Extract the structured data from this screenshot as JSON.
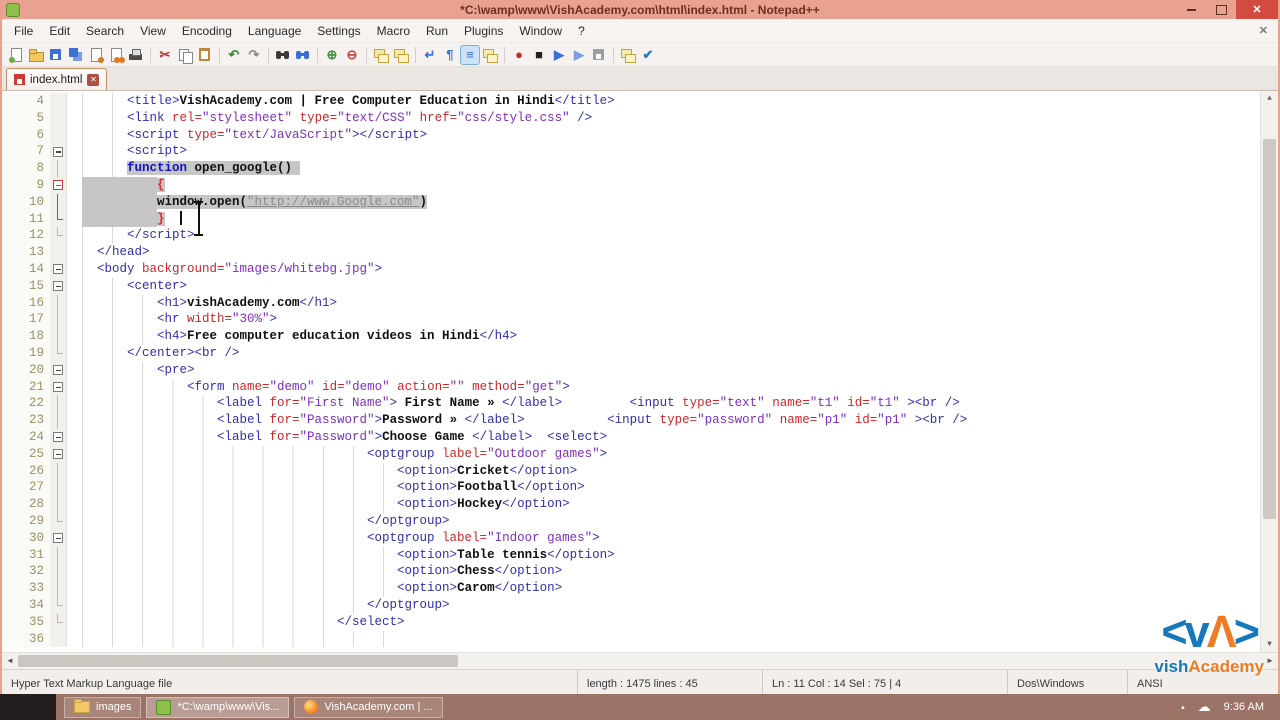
{
  "window": {
    "title": "*C:\\wamp\\www\\VishAcademy.com\\html\\index.html - Notepad++",
    "close_glyph": "✕",
    "doc_close_glyph": "✕"
  },
  "menu": {
    "items": [
      {
        "label": "File",
        "name": "file"
      },
      {
        "label": "Edit",
        "name": "edit"
      },
      {
        "label": "Search",
        "name": "search"
      },
      {
        "label": "View",
        "name": "view"
      },
      {
        "label": "Encoding",
        "name": "encoding"
      },
      {
        "label": "Language",
        "name": "language"
      },
      {
        "label": "Settings",
        "name": "settings"
      },
      {
        "label": "Macro",
        "name": "macro"
      },
      {
        "label": "Run",
        "name": "run"
      },
      {
        "label": "Plugins",
        "name": "plugins"
      },
      {
        "label": "Window",
        "name": "window"
      },
      {
        "label": "?",
        "name": "help"
      }
    ]
  },
  "toolbar": {
    "items": [
      {
        "name": "new-file",
        "type": "pagenew"
      },
      {
        "name": "open-file",
        "type": "folder"
      },
      {
        "name": "save",
        "type": "disk"
      },
      {
        "name": "save-all",
        "type": "disk2"
      },
      {
        "name": "close",
        "type": "pagedot"
      },
      {
        "name": "close-all",
        "type": "pagedot2"
      },
      {
        "name": "print",
        "type": "printer"
      },
      {
        "sep": true
      },
      {
        "name": "cut",
        "glyph": "✂",
        "color": "#b03030"
      },
      {
        "name": "copy",
        "type": "pages"
      },
      {
        "name": "paste",
        "type": "clipboard"
      },
      {
        "sep": true
      },
      {
        "name": "undo",
        "glyph": "↶",
        "color": "#2e8b2e"
      },
      {
        "name": "redo",
        "glyph": "↷",
        "color": "#8a8a8a"
      },
      {
        "sep": true
      },
      {
        "name": "find",
        "type": "binoc"
      },
      {
        "name": "replace",
        "type": "binocb"
      },
      {
        "sep": true
      },
      {
        "name": "zoom-in",
        "glyph": "⊕",
        "color": "#3f8f3f"
      },
      {
        "name": "zoom-out",
        "glyph": "⊖",
        "color": "#c04040"
      },
      {
        "sep": true
      },
      {
        "name": "sync-vertical-scrolling",
        "type": "winpair"
      },
      {
        "name": "sync-horizontal-scrolling",
        "type": "winpair"
      },
      {
        "sep": true
      },
      {
        "name": "word-wrap",
        "glyph": "↵",
        "color": "#3a6fd8"
      },
      {
        "name": "show-all-characters",
        "glyph": "¶",
        "color": "#3a6fd8"
      },
      {
        "name": "show-indent-guide",
        "glyph": "≡",
        "color": "#3a6fd8",
        "active": true
      },
      {
        "name": "user-defined-dialog",
        "type": "winpair"
      },
      {
        "sep": true
      },
      {
        "name": "record-macro",
        "glyph": "●",
        "color": "#c03030"
      },
      {
        "name": "stop-recording",
        "glyph": "■",
        "color": "#222222"
      },
      {
        "name": "play-macro",
        "glyph": "▶",
        "color": "#3a6fd8"
      },
      {
        "name": "run-macro-multiple",
        "glyph": "▶",
        "color": "#7d9ce0"
      },
      {
        "name": "save-macro",
        "type": "diskg"
      },
      {
        "sep": true
      },
      {
        "name": "document-map",
        "type": "winpair"
      },
      {
        "name": "spell-check",
        "glyph": "✔",
        "color": "#2a7ab8"
      }
    ]
  },
  "tabs": [
    {
      "label": "index.html",
      "state": "unsaved"
    }
  ],
  "editor": {
    "first_line": 4,
    "lines": [
      {
        "n": 4,
        "ind": 6,
        "f": "",
        "segs": [
          [
            "g",
            "<title>"
          ],
          [
            "t",
            "VishAcademy.com | Free Computer Education in Hindi"
          ],
          [
            "g",
            "</title>"
          ]
        ]
      },
      {
        "n": 5,
        "ind": 6,
        "f": "",
        "segs": [
          [
            "g",
            "<link "
          ],
          [
            "a",
            "rel="
          ],
          [
            "v",
            "\"stylesheet\""
          ],
          [
            "p",
            " "
          ],
          [
            "a",
            "type="
          ],
          [
            "v",
            "\"text/CSS\""
          ],
          [
            "p",
            " "
          ],
          [
            "a",
            "href="
          ],
          [
            "v",
            "\"css/style.css\""
          ],
          [
            "g",
            " />"
          ]
        ]
      },
      {
        "n": 6,
        "ind": 6,
        "f": "",
        "segs": [
          [
            "g",
            "<script "
          ],
          [
            "a",
            "type="
          ],
          [
            "v",
            "\"text/JavaScript\""
          ],
          [
            "g",
            "></script>"
          ]
        ]
      },
      {
        "n": 7,
        "ind": 6,
        "f": "box",
        "segs": [
          [
            "g",
            "<script>"
          ]
        ]
      },
      {
        "n": 8,
        "ind": 6,
        "f": "line",
        "segs": [
          [
            "k",
            "function",
            1
          ],
          [
            "t",
            " open_google()",
            1
          ],
          [
            "p",
            " ",
            1
          ]
        ]
      },
      {
        "n": 9,
        "ind": 10,
        "isel": 1,
        "f": "boxr",
        "segs": [
          [
            "b",
            "{",
            1
          ]
        ]
      },
      {
        "n": 10,
        "ind": 10,
        "isel": 1,
        "f": "liner",
        "segs": [
          [
            "t",
            "window.open(",
            1
          ],
          [
            "su",
            "\"http://www.Google.com\"",
            1
          ],
          [
            "t",
            ")",
            1
          ]
        ]
      },
      {
        "n": 11,
        "ind": 10,
        "isel": 1,
        "f": "endr",
        "segs": [
          [
            "b",
            "}",
            1
          ]
        ]
      },
      {
        "n": 12,
        "ind": 6,
        "f": "end",
        "segs": [
          [
            "g",
            "</script>"
          ]
        ]
      },
      {
        "n": 13,
        "ind": 2,
        "f": "",
        "segs": [
          [
            "g",
            "</head>"
          ]
        ]
      },
      {
        "n": 14,
        "ind": 2,
        "f": "box",
        "segs": [
          [
            "g",
            "<body "
          ],
          [
            "a",
            "background="
          ],
          [
            "v",
            "\"images/whitebg.jpg\""
          ],
          [
            "g",
            ">"
          ]
        ]
      },
      {
        "n": 15,
        "ind": 6,
        "f": "box",
        "segs": [
          [
            "g",
            "<center>"
          ]
        ]
      },
      {
        "n": 16,
        "ind": 10,
        "f": "line",
        "segs": [
          [
            "g",
            "<h1>"
          ],
          [
            "t",
            "vishAcademy.com"
          ],
          [
            "g",
            "</h1>"
          ]
        ]
      },
      {
        "n": 17,
        "ind": 10,
        "f": "line",
        "segs": [
          [
            "g",
            "<hr "
          ],
          [
            "a",
            "width="
          ],
          [
            "v",
            "\"30%\""
          ],
          [
            "g",
            ">"
          ]
        ]
      },
      {
        "n": 18,
        "ind": 10,
        "f": "line",
        "segs": [
          [
            "g",
            "<h4>"
          ],
          [
            "t",
            "Free computer education videos in Hindi"
          ],
          [
            "g",
            "</h4>"
          ]
        ]
      },
      {
        "n": 19,
        "ind": 6,
        "f": "end",
        "segs": [
          [
            "g",
            "</center>"
          ],
          [
            "g",
            "<br />"
          ]
        ]
      },
      {
        "n": 20,
        "ind": 10,
        "f": "box",
        "segs": [
          [
            "g",
            "<pre>"
          ]
        ]
      },
      {
        "n": 21,
        "ind": 14,
        "f": "box",
        "segs": [
          [
            "g",
            "<form "
          ],
          [
            "a",
            "name="
          ],
          [
            "v",
            "\"demo\""
          ],
          [
            "p",
            " "
          ],
          [
            "a",
            "id="
          ],
          [
            "v",
            "\"demo\""
          ],
          [
            "p",
            " "
          ],
          [
            "a",
            "action="
          ],
          [
            "v",
            "\"\""
          ],
          [
            "p",
            " "
          ],
          [
            "a",
            "method="
          ],
          [
            "v",
            "\"get\""
          ],
          [
            "g",
            ">"
          ]
        ]
      },
      {
        "n": 22,
        "ind": 18,
        "f": "line",
        "segs": [
          [
            "g",
            "<label "
          ],
          [
            "a",
            "for="
          ],
          [
            "v",
            "\"First Name\""
          ],
          [
            "g",
            ">"
          ],
          [
            "t",
            " First Name » "
          ],
          [
            "g",
            "</label>"
          ],
          [
            "p",
            "         "
          ],
          [
            "g",
            "<input "
          ],
          [
            "a",
            "type="
          ],
          [
            "v",
            "\"text\""
          ],
          [
            "p",
            " "
          ],
          [
            "a",
            "name="
          ],
          [
            "v",
            "\"t1\""
          ],
          [
            "p",
            " "
          ],
          [
            "a",
            "id="
          ],
          [
            "v",
            "\"t1\""
          ],
          [
            "g",
            " >"
          ],
          [
            "g",
            "<br />"
          ]
        ]
      },
      {
        "n": 23,
        "ind": 18,
        "f": "line",
        "segs": [
          [
            "g",
            "<label "
          ],
          [
            "a",
            "for="
          ],
          [
            "v",
            "\"Password\""
          ],
          [
            "g",
            ">"
          ],
          [
            "t",
            "Password » "
          ],
          [
            "g",
            "</label>"
          ],
          [
            "p",
            "           "
          ],
          [
            "g",
            "<input "
          ],
          [
            "a",
            "type="
          ],
          [
            "v",
            "\"password\""
          ],
          [
            "p",
            " "
          ],
          [
            "a",
            "name="
          ],
          [
            "v",
            "\"p1\""
          ],
          [
            "p",
            " "
          ],
          [
            "a",
            "id="
          ],
          [
            "v",
            "\"p1\""
          ],
          [
            "g",
            " >"
          ],
          [
            "g",
            "<br />"
          ]
        ]
      },
      {
        "n": 24,
        "ind": 18,
        "f": "box",
        "segs": [
          [
            "g",
            "<label "
          ],
          [
            "a",
            "for="
          ],
          [
            "v",
            "\"Password\""
          ],
          [
            "g",
            ">"
          ],
          [
            "t",
            "Choose Game "
          ],
          [
            "g",
            "</label>"
          ],
          [
            "p",
            "  "
          ],
          [
            "g",
            "<select>"
          ]
        ]
      },
      {
        "n": 25,
        "ind": 38,
        "f": "box",
        "segs": [
          [
            "g",
            "<optgroup "
          ],
          [
            "a",
            "label="
          ],
          [
            "v",
            "\"Outdoor games\""
          ],
          [
            "g",
            ">"
          ]
        ]
      },
      {
        "n": 26,
        "ind": 42,
        "f": "line",
        "segs": [
          [
            "g",
            "<option>"
          ],
          [
            "t",
            "Cricket"
          ],
          [
            "g",
            "</option>"
          ]
        ]
      },
      {
        "n": 27,
        "ind": 42,
        "f": "line",
        "segs": [
          [
            "g",
            "<option>"
          ],
          [
            "t",
            "Football"
          ],
          [
            "g",
            "</option>"
          ]
        ]
      },
      {
        "n": 28,
        "ind": 42,
        "f": "line",
        "segs": [
          [
            "g",
            "<option>"
          ],
          [
            "t",
            "Hockey"
          ],
          [
            "g",
            "</option>"
          ]
        ]
      },
      {
        "n": 29,
        "ind": 38,
        "f": "end",
        "segs": [
          [
            "g",
            "</optgroup>"
          ]
        ]
      },
      {
        "n": 30,
        "ind": 38,
        "f": "box",
        "segs": [
          [
            "g",
            "<optgroup "
          ],
          [
            "a",
            "label="
          ],
          [
            "v",
            "\"Indoor games\""
          ],
          [
            "g",
            ">"
          ]
        ]
      },
      {
        "n": 31,
        "ind": 42,
        "f": "line",
        "segs": [
          [
            "g",
            "<option>"
          ],
          [
            "t",
            "Table tennis"
          ],
          [
            "g",
            "</option>"
          ]
        ]
      },
      {
        "n": 32,
        "ind": 42,
        "f": "line",
        "segs": [
          [
            "g",
            "<option>"
          ],
          [
            "t",
            "Chess"
          ],
          [
            "g",
            "</option>"
          ]
        ]
      },
      {
        "n": 33,
        "ind": 42,
        "f": "line",
        "segs": [
          [
            "g",
            "<option>"
          ],
          [
            "t",
            "Carom"
          ],
          [
            "g",
            "</option>"
          ]
        ]
      },
      {
        "n": 34,
        "ind": 38,
        "f": "end",
        "segs": [
          [
            "g",
            "</optgroup>"
          ]
        ]
      },
      {
        "n": 35,
        "ind": 34,
        "f": "end",
        "segs": [
          [
            "g",
            "</select>"
          ]
        ]
      },
      {
        "n": 36,
        "ind": 44,
        "f": "",
        "segs": []
      }
    ]
  },
  "scrollbar_glyphs": {
    "up": "▲",
    "down": "▼",
    "left": "◄",
    "right": "►"
  },
  "status_bar": {
    "panels": [
      {
        "name": "doc-type",
        "text": "Hyper Text Markup Language file"
      },
      {
        "name": "doc-size",
        "text": "length : 1475    lines : 45"
      },
      {
        "name": "cursor-position",
        "text": "Ln : 11    Col : 14    Sel : 75 | 4"
      },
      {
        "name": "eol-format",
        "text": "Dos\\Windows"
      },
      {
        "name": "encoding",
        "text": "ANSI"
      }
    ]
  },
  "taskbar": {
    "buttons": [
      {
        "name": "taskbar-images-folder",
        "icon": "folder",
        "label": "images"
      },
      {
        "name": "taskbar-notepad",
        "icon": "npp",
        "label": "*C:\\wamp\\www\\Vis...",
        "active": true
      },
      {
        "name": "taskbar-firefox",
        "icon": "ff",
        "label": "VishAcademy.com | ..."
      }
    ],
    "tray": {
      "expand": "▴",
      "cloud": "☁",
      "clock": "9:36 AM"
    }
  },
  "watermark": {
    "mark_left": "<v",
    "mark_mid": "Λ",
    "mark_right": ">",
    "text_left": "vish",
    "text_right": "Academy",
    "blue": "#1778bb",
    "orange": "#ee7c24"
  }
}
